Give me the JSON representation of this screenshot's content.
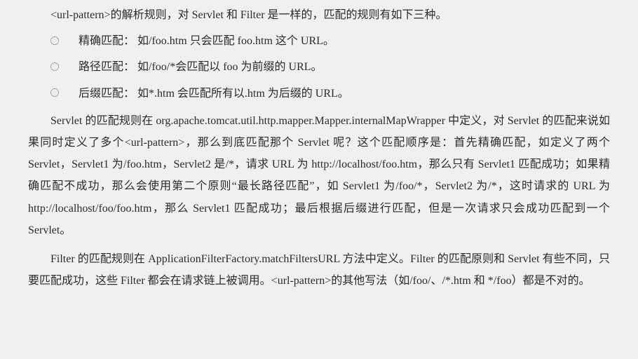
{
  "intro": "<url-pattern>的解析规则，对 Servlet 和 Filter 是一样的，匹配的规则有如下三种。",
  "bullets": [
    "精确匹配： 如/foo.htm 只会匹配 foo.htm 这个 URL。",
    "路径匹配： 如/foo/*会匹配以 foo 为前缀的 URL。",
    "后缀匹配： 如*.htm 会匹配所有以.htm 为后缀的 URL。"
  ],
  "para1": "Servlet 的匹配规则在 org.apache.tomcat.util.http.mapper.Mapper.internalMapWrapper 中定义，对 Servlet 的匹配来说如果同时定义了多个<url-pattern>，那么到底匹配那个 Servlet 呢？这个匹配顺序是：首先精确匹配，如定义了两个 Servlet，Servlet1 为/foo.htm，Servlet2 是/*，请求 URL 为 http://localhost/foo.htm，那么只有 Servlet1 匹配成功；如果精确匹配不成功，那么会使用第二个原则“最长路径匹配”，如 Servlet1 为/foo/*，Servlet2 为/*，这时请求的 URL 为 http://localhost/foo/foo.htm，那么 Servlet1 匹配成功；最后根据后缀进行匹配，但是一次请求只会成功匹配到一个 Servlet。",
  "para2": "Filter 的匹配规则在 ApplicationFilterFactory.matchFiltersURL 方法中定义。Filter 的匹配原则和 Servlet 有些不同，只要匹配成功，这些 Filter 都会在请求链上被调用。<url-pattern>的其他写法（如/foo/、/*.htm 和 */foo）都是不对的。"
}
